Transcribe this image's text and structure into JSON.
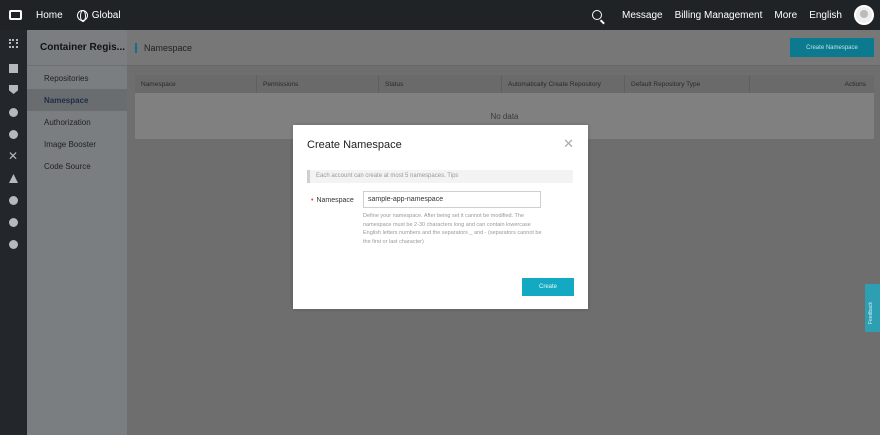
{
  "topbar": {
    "home": "Home",
    "region": "Global",
    "message": "Message",
    "billing": "Billing Management",
    "more": "More",
    "language": "English"
  },
  "rail_icons": [
    "grid-icon",
    "block-icon",
    "shield-icon",
    "cloud-icon",
    "cloud-icon",
    "x-icon",
    "nodes-icon",
    "globe-icon",
    "mask-icon",
    "gear-icon"
  ],
  "sidebar": {
    "title": "Container Regis...",
    "items": [
      {
        "label": "Repositories"
      },
      {
        "label": "Namespace"
      },
      {
        "label": "Authorization"
      },
      {
        "label": "Image Booster"
      },
      {
        "label": "Code Source"
      }
    ],
    "active_index": 1
  },
  "page": {
    "title": "Namespace",
    "create_button": "Create Namespace"
  },
  "table": {
    "columns": [
      "Namespace",
      "Permissions",
      "Status",
      "Automatically Create Repository",
      "Default Repository Type",
      "Actions"
    ],
    "empty_text": "No data"
  },
  "modal": {
    "title": "Create Namespace",
    "tip": "Each account can create at most 5 namespaces. Tips",
    "label": "Namespace",
    "input_value": "sample-app-namespace",
    "help": "Define your namespace. After being set it cannot be modified. The namespace must be 2-30 characters long and can contain lowercase English letters numbers and the separators _ and - (separators cannot be the first or last character)",
    "ok": "Create"
  },
  "feedback": "Feedback",
  "colors": {
    "topbar": "#1f2326",
    "accent": "#14a9c2",
    "overlay": "#6e6e6e"
  }
}
